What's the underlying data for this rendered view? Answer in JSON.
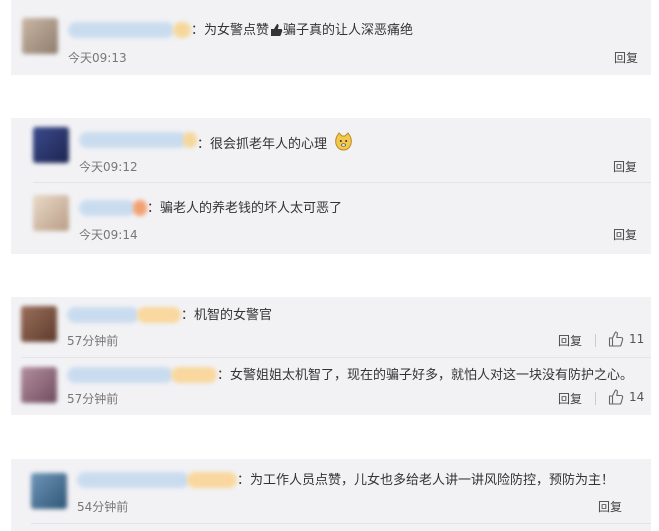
{
  "reply_label": "回复",
  "sep_colon": "：",
  "card1": {
    "text_pre": "为女警点赞",
    "text_post": "骗子真的让人深恶痛绝",
    "time": "今天09:13"
  },
  "card2": {
    "main": {
      "text": "很会抓老年人的心理",
      "time": "今天09:12"
    },
    "sub": {
      "text": "骗老人的养老钱的坏人太可恶了",
      "time": "今天09:14"
    }
  },
  "card3": {
    "main": {
      "text": "机智的女警官",
      "time": "57分钟前",
      "likes": "11"
    },
    "sub": {
      "text": "女警姐姐太机智了，现在的骗子好多，就怕人对这一块没有防护之心。",
      "time": "57分钟前",
      "likes": "14"
    }
  },
  "card4": {
    "text": "为工作人员点赞，儿女也多给老人讲一讲风险防控，预防为主！",
    "time": "54分钟前"
  },
  "icons": {
    "card1_emoji": "thumbs-up-hand-icon",
    "card2_emoji": "doge-face-icon",
    "like": "thumbs-up-icon"
  },
  "colors": {
    "card_bg": "#f2f2f5",
    "muted_text": "#777777",
    "badge_orange": "#f7b36b"
  }
}
